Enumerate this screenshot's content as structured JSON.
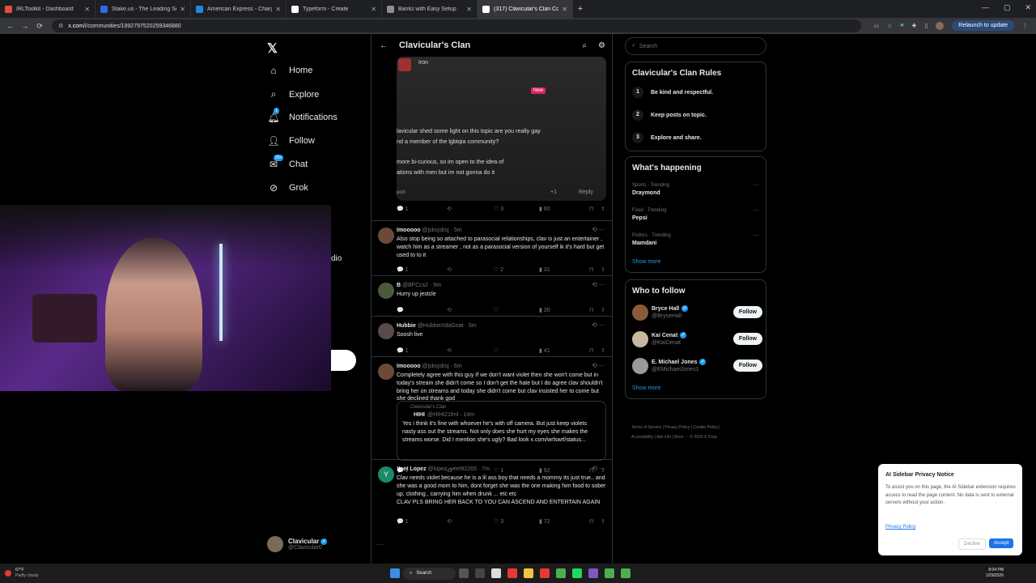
{
  "tabs": [
    {
      "label": "IRLToolkit - Dashboard",
      "color": "#e74c3c"
    },
    {
      "label": "Stake.us - The Leading Social C",
      "color": "#2d6cdf"
    },
    {
      "label": "American Express - Charge Ver",
      "color": "#1e88e5"
    },
    {
      "label": "Typeform - Create",
      "color": "#ffffff"
    },
    {
      "label": "Banks with Easy Setup",
      "color": "#8e8e8e"
    },
    {
      "label": "(317) Clavicular's Clan Commu",
      "color": "#ffffff",
      "active": true
    }
  ],
  "window_controls": [
    "—",
    "▢",
    "✕"
  ],
  "address": {
    "url_host": "x.com",
    "url_path": "/i/communities/1992797520259346880",
    "relaunch": "Relaunch to update"
  },
  "nav": {
    "items": [
      {
        "label": "Home",
        "icon": "home-icon"
      },
      {
        "label": "Explore",
        "icon": "search-icon"
      },
      {
        "label": "Notifications",
        "icon": "bell-icon",
        "badge": "1"
      },
      {
        "label": "Follow",
        "icon": "add-person-icon"
      },
      {
        "label": "Chat",
        "icon": "mail-icon",
        "badge": "20+"
      },
      {
        "label": "Grok",
        "icon": "grok-icon"
      }
    ],
    "partial_text": "dio",
    "profile": {
      "name": "Clavicular",
      "handle": "@Clavicular0"
    }
  },
  "feed": {
    "title": "Clavicular's Clan",
    "image_post": {
      "line_top": "Iron",
      "new_badge": "New",
      "line1": "lavicular shed some light on this topic are you really gay",
      "line2": "nd a member of the lgbtqia community?",
      "line3": "more bi-curious, so im open to the idea of",
      "line4": "ations with men but im not gonna do it",
      "reply": "Reply",
      "likes": "+1",
      "short": "port"
    },
    "image_post_actions": {
      "replies": "1",
      "likes": "3",
      "views": "60"
    },
    "posts": [
      {
        "name": "Imooooo",
        "handle": "@jsksjsbsj · 5m",
        "text": "Also stop being so attached to parasocial relationships, clav is just an entertainer , watch him as a streamer , not as a parasocial version of yourself ik it's hard but get used to to it",
        "replies": "1",
        "likes": "2",
        "views": "31",
        "avatar": "#6b4a3a"
      },
      {
        "name": "B",
        "handle": "@BFCcs2 · 5m",
        "text": "Hurry up jestcle",
        "replies": "",
        "likes": "",
        "views": "30",
        "avatar": "#4a5a3a"
      },
      {
        "name": "Hubbie",
        "handle": "@HubbieXdaGoat · 5m",
        "text": "Soosh live",
        "replies": "1",
        "likes": "",
        "views": "41",
        "avatar": "#5a4a4a"
      },
      {
        "name": "Imooooo",
        "handle": "@jsksjsbsj · 6m",
        "text": "Completely agree with this guy If we don't want violet then she won't come but in today's stream she didn't come so I don't get the hate but I do agree clav shouldn't bring her on streams and today she didn't come but clav insisted her to come but she declined thank god",
        "replies": "1",
        "likes": "1",
        "views": "92",
        "avatar": "#6b4a3a",
        "quote": {
          "community": "Clavicular's Clan",
          "name": "HIHI",
          "handle": "@HIHI21fml · 14m",
          "text": "Yes i think it's fine with whoever he's with off camera. But just keep violets nasty ass out the streams. Not only does she hurt my eyes she makes the streams worse. Did I mention she's ugly? Bad look x.com/wrlswrl/status..."
        }
      },
      {
        "name": "Yeet Lopez",
        "handle": "@lopez_yeet92265 · 7m",
        "text": "Clav needs violet because he is a lil ass boy that needs a mommy its just true.. and she was a good mom to him, dont forget she was the one making him food to sober up, clothing , carrying him when drunk ... etc etc",
        "text2": "CLAV PLS BRING HER BACK TO YOU CAN ASCEND AND ENTERTAIN AGAIN",
        "replies": "1",
        "likes": "3",
        "views": "72",
        "avatar": "#1a8a6a",
        "initial": "Y"
      }
    ]
  },
  "right": {
    "search_placeholder": "Search",
    "rules_title": "Clavicular's Clan Rules",
    "rules": [
      {
        "n": "1",
        "text": "Be kind and respectful."
      },
      {
        "n": "2",
        "text": "Keep posts on topic."
      },
      {
        "n": "3",
        "text": "Explore and share."
      }
    ],
    "happening_title": "What's happening",
    "trends": [
      {
        "cat": "Sports · Trending",
        "name": "Draymond"
      },
      {
        "cat": "Food · Trending",
        "name": "Pepsi"
      },
      {
        "cat": "Politics · Trending",
        "name": "Mamdani"
      }
    ],
    "show_more": "Show more",
    "wtf_title": "Who to follow",
    "follow_label": "Follow",
    "who_to_follow": [
      {
        "name": "Bryce Hall",
        "handle": "@BryceHall",
        "color": "#8a5a3a"
      },
      {
        "name": "Kai Cenat",
        "handle": "@KaiCenat",
        "color": "#c8b8a0"
      },
      {
        "name": "E. Michael Jones",
        "handle": "@EMichaelJones1",
        "color": "#9a9a9a"
      }
    ],
    "footer1": "Terms of Service | Privacy Policy | Cookie Policy |",
    "footer2": "Accessibility | Ads info | More ··· © 2026 X Corp."
  },
  "privacy": {
    "title": "AI Sidebar Privacy Notice",
    "body": "To assist you on this page, the AI Sidebar extension requires access to read the page content. No data is sent to external servers without your action.",
    "link": "Privacy Policy",
    "decline": "Decline",
    "accept": "Accept"
  },
  "taskbar": {
    "weather_temp": "67°F",
    "weather_desc": "Partly cloudy",
    "search": "Search",
    "time": "8:04 PM",
    "date": "1/29/2026"
  }
}
